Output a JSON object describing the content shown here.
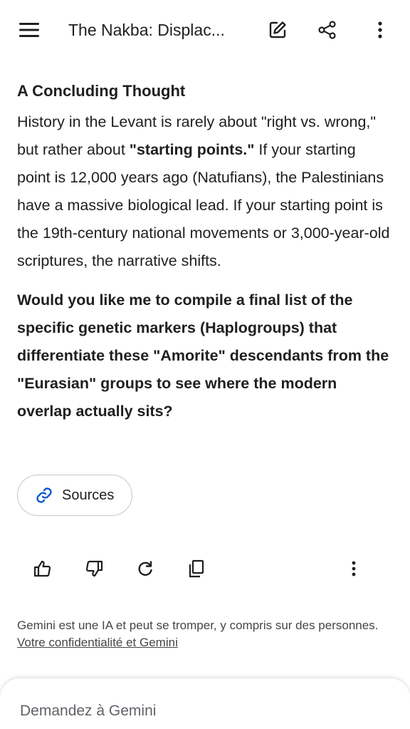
{
  "header": {
    "title": "The Nakba: Displac...",
    "icons": [
      "menu-icon",
      "edit-icon",
      "share-icon",
      "more-vert-icon"
    ]
  },
  "response": {
    "heading": "A Concluding Thought",
    "para_part1": "History in the Levant is rarely about \"right vs. wrong,\" but rather about ",
    "para_bold": "\"starting points.\"",
    "para_part2": " If your starting point is 12,000 years ago (Natufians), the Palestinians have a massive biological lead. If your starting point is the 19th-century national movements or 3,000-year-old scriptures, the narrative shifts.",
    "question": "Would you like me to compile a final list of the specific genetic markers (Haplogroups) that differentiate these \"Amorite\" descendants from the \"Eurasian\" groups to see where the modern overlap actually sits?"
  },
  "sources": {
    "label": "Sources",
    "icon": "link-icon"
  },
  "actions": [
    "thumbs-up-icon",
    "thumbs-down-icon",
    "regenerate-icon",
    "copy-icon",
    "more-vert-icon"
  ],
  "disclaimer": {
    "text": "Gemini est une IA et peut se tromper, y compris sur des personnes. ",
    "link": "Votre confidentialité et Gemini"
  },
  "input": {
    "placeholder": "Demandez à Gemini"
  },
  "colors": {
    "text": "#1f1f1f",
    "link_icon": "#0b57d0",
    "border": "#c4c7c5",
    "muted": "#444746"
  }
}
